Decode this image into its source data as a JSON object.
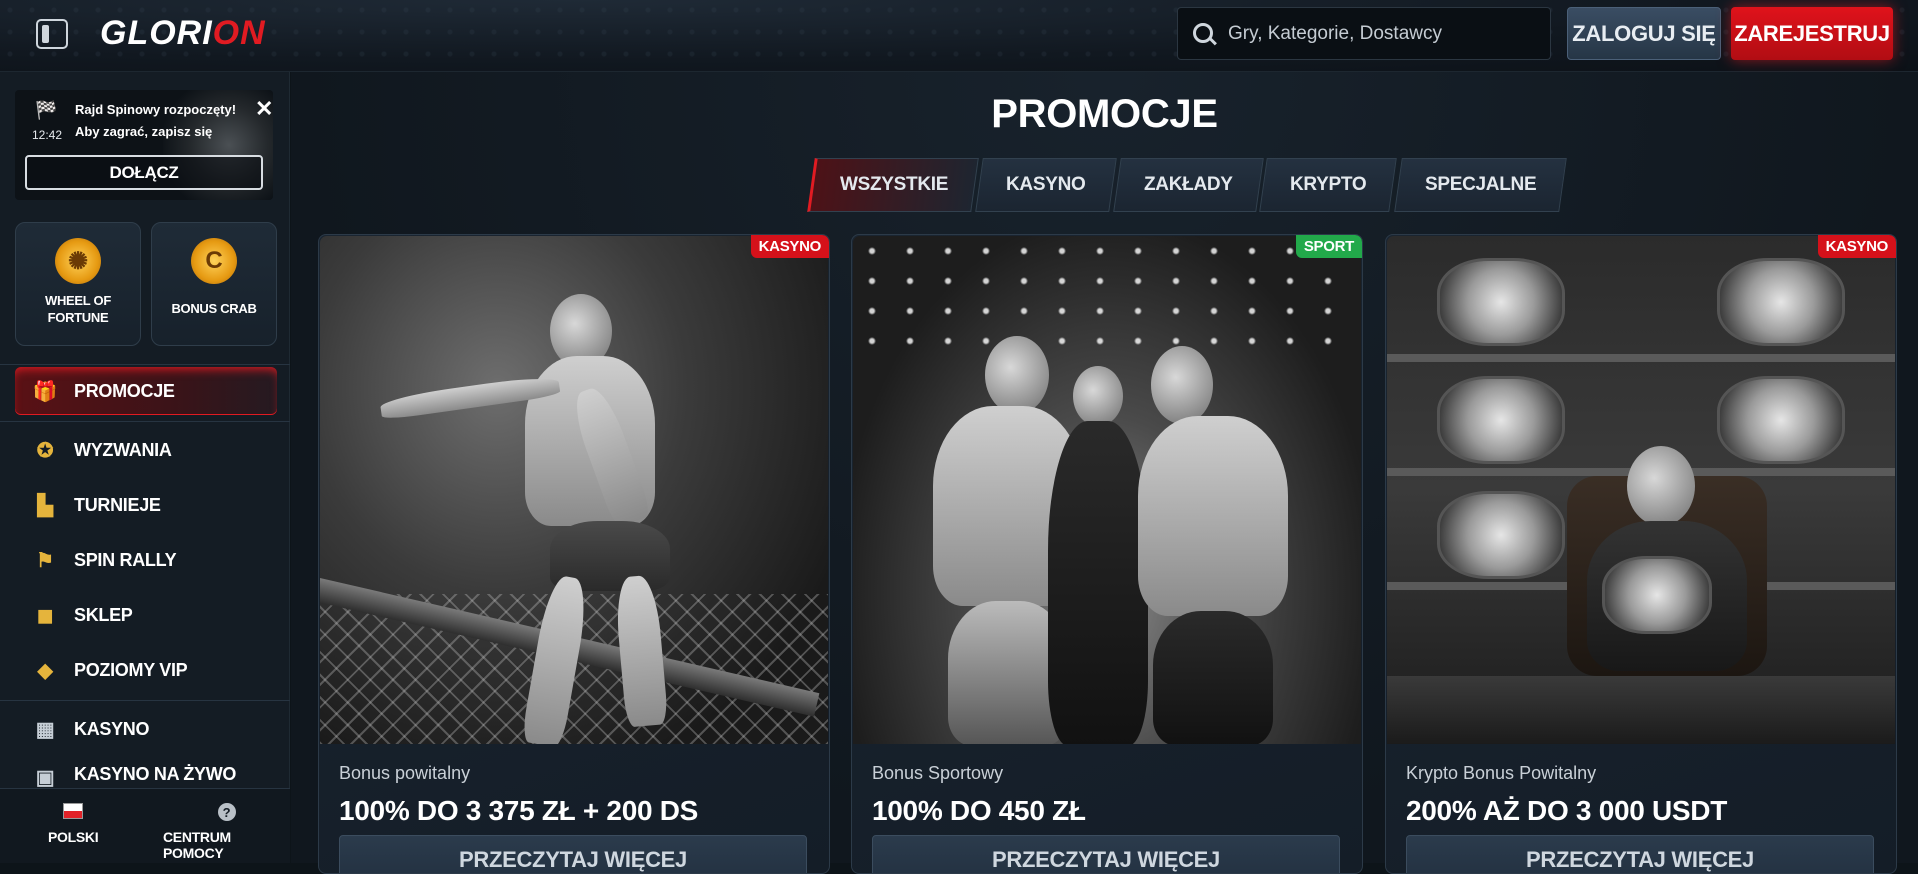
{
  "header": {
    "logo_part1": "GLORI",
    "logo_part2": "ON",
    "search_placeholder": "Gry, Kategorie, Dostawcy",
    "login_label": "ZALOGUJ SIĘ",
    "register_label": "ZAREJESTRUJ"
  },
  "sidebar": {
    "notice": {
      "title": "Rajd Spinowy rozpoczęty!",
      "subtitle": "Aby zagrać, zapisz się",
      "time": "12:42",
      "join_label": "DOŁĄCZ"
    },
    "tiles": [
      {
        "label": "WHEEL OF FORTUNE",
        "icon": "wheel-icon"
      },
      {
        "label": "BONUS CRAB",
        "icon": "crab-claw-icon"
      }
    ],
    "nav": [
      {
        "label": "PROMOCJE",
        "icon": "gift-icon",
        "active": true
      },
      {
        "label": "WYZWANIA",
        "icon": "medal-icon"
      },
      {
        "label": "TURNIEJE",
        "icon": "podium-icon"
      },
      {
        "label": "SPIN RALLY",
        "icon": "checkered-flag-icon"
      },
      {
        "label": "SKLEP",
        "icon": "shopping-bag-icon"
      },
      {
        "label": "POZIOMY VIP",
        "icon": "diamond-icon"
      },
      {
        "label": "KASYNO",
        "icon": "slot-machine-icon"
      },
      {
        "label": "KASYNO NA ŻYWO",
        "icon": "live-casino-icon"
      }
    ],
    "footer": {
      "language": "POLSKI",
      "help": "CENTRUM POMOCY"
    }
  },
  "main": {
    "title": "PROMOCJE",
    "tabs": [
      "WSZYSTKIE",
      "KASYNO",
      "ZAKŁADY",
      "KRYPTO",
      "SPECJALNE"
    ],
    "active_tab": "WSZYSTKIE",
    "cards": [
      {
        "badge": "KASYNO",
        "badge_color": "#d5111a",
        "subtitle": "Bonus powitalny",
        "title": "100% DO 3 375 ZŁ + 200 DS",
        "button": "PRZECZYTAJ WIĘCEJ"
      },
      {
        "badge": "SPORT",
        "badge_color": "#22a94a",
        "subtitle": "Bonus Sportowy",
        "title": "100% DO 450 ZŁ",
        "button": "PRZECZYTAJ WIĘCEJ"
      },
      {
        "badge": "KASYNO",
        "badge_color": "#d5111a",
        "subtitle": "Krypto Bonus Powitalny",
        "title": "200% AŻ DO 3 000 USDT",
        "button": "PRZECZYTAJ WIĘCEJ"
      }
    ]
  },
  "colors": {
    "accent": "#e11b22",
    "background": "#0d1419",
    "sidebar": "#141c24",
    "gold": "#e5b43c"
  }
}
